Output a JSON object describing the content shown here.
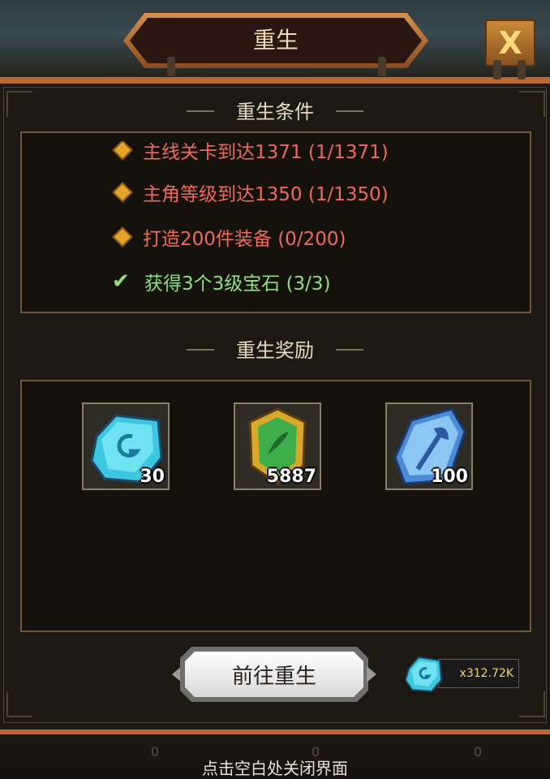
{
  "window": {
    "title": "重生"
  },
  "close_button": {
    "label": "X"
  },
  "conditions": {
    "title": "重生条件",
    "items": [
      {
        "text": "主线关卡到达1371 (1/1371)",
        "done": false
      },
      {
        "text": "主角等级到达1350 (1/1350)",
        "done": false
      },
      {
        "text": "打造200件装备 (0/200)",
        "done": false
      },
      {
        "text": "获得3个3级宝石 (3/3)",
        "done": true
      }
    ]
  },
  "rewards": {
    "title": "重生奖励",
    "items": [
      {
        "icon": "blue-rune-stone-icon",
        "count": "30"
      },
      {
        "icon": "green-emblem-gem-icon",
        "count": "5887"
      },
      {
        "icon": "axe-rune-stone-icon",
        "count": "100"
      }
    ]
  },
  "action": {
    "go_rebirth_label": "前往重生"
  },
  "resource": {
    "icon": "blue-rune-stone-icon",
    "amount": "x312.72K"
  },
  "footer": {
    "slot_values": [
      "0",
      "0",
      "0"
    ],
    "hint": "点击空白处关闭界面"
  },
  "colors": {
    "unmet": "#f06a5a",
    "met": "#8fe07a",
    "frame": "#b86a30"
  }
}
